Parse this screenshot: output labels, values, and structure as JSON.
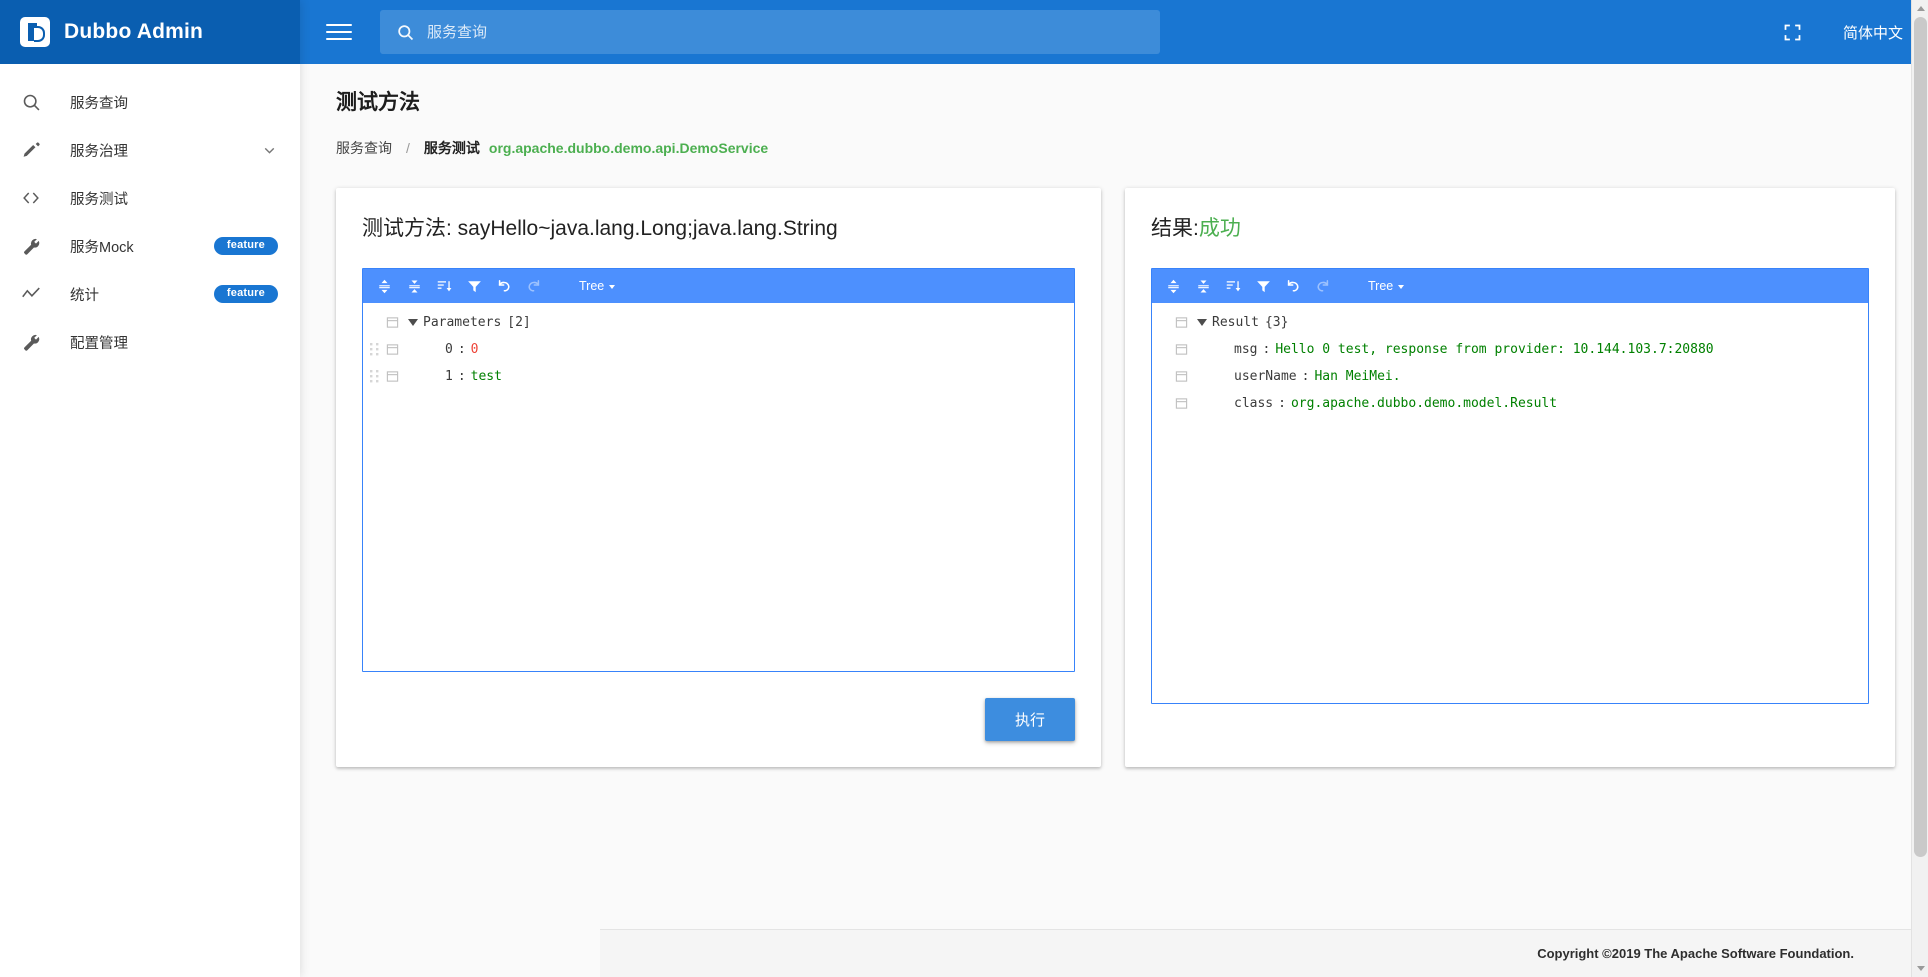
{
  "brand": {
    "title": "Dubbo Admin",
    "logo_icon": "dubbo-logo-icon"
  },
  "sidebar": {
    "items": [
      {
        "label": "服务查询",
        "icon": "search-icon",
        "badge": null,
        "chevron": false
      },
      {
        "label": "服务治理",
        "icon": "pencil-icon",
        "badge": null,
        "chevron": true
      },
      {
        "label": "服务测试",
        "icon": "code-brackets-icon",
        "badge": null,
        "chevron": false
      },
      {
        "label": "服务Mock",
        "icon": "wrench-icon",
        "badge": "feature",
        "chevron": false
      },
      {
        "label": "统计",
        "icon": "chart-line-icon",
        "badge": "feature",
        "chevron": false
      },
      {
        "label": "配置管理",
        "icon": "wrench-icon",
        "badge": null,
        "chevron": false
      }
    ]
  },
  "topbar": {
    "menu_icon": "hamburger-icon",
    "search_icon": "search-icon",
    "search_value": "",
    "search_placeholder": "服务查询",
    "fullscreen_icon": "fullscreen-icon",
    "language": "简体中文"
  },
  "page": {
    "title": "测试方法",
    "breadcrumb": {
      "root": "服务查询",
      "separator": "/",
      "current": "服务测试",
      "service": "org.apache.dubbo.demo.api.DemoService"
    }
  },
  "left_card": {
    "title_prefix": "测试方法: ",
    "method": "sayHello~java.lang.Long;java.lang.String",
    "editor": {
      "mode_label": "Tree",
      "buttons": [
        {
          "name": "expand-all-icon",
          "title": "Expand all fields"
        },
        {
          "name": "collapse-all-icon",
          "title": "Collapse all fields"
        },
        {
          "name": "sort-icon",
          "title": "Sort"
        },
        {
          "name": "filter-icon",
          "title": "Filter"
        },
        {
          "name": "undo-icon",
          "title": "Undo"
        },
        {
          "name": "redo-icon",
          "title": "Redo"
        }
      ],
      "rows": [
        {
          "key": "Parameters",
          "count": "[2]",
          "value": null,
          "vtype": "none",
          "root": true,
          "indent": 0
        },
        {
          "key": "0",
          "count": null,
          "value": "0",
          "vtype": "number",
          "root": false,
          "indent": 1
        },
        {
          "key": "1",
          "count": null,
          "value": "test",
          "vtype": "string",
          "root": false,
          "indent": 1
        }
      ]
    },
    "execute_label": "执行"
  },
  "right_card": {
    "title_prefix": "结果:",
    "status": "成功",
    "editor": {
      "mode_label": "Tree",
      "buttons": [
        {
          "name": "expand-all-icon",
          "title": "Expand all fields"
        },
        {
          "name": "collapse-all-icon",
          "title": "Collapse all fields"
        },
        {
          "name": "sort-icon",
          "title": "Sort"
        },
        {
          "name": "filter-icon",
          "title": "Filter"
        },
        {
          "name": "undo-icon",
          "title": "Undo"
        },
        {
          "name": "redo-icon",
          "title": "Redo"
        }
      ],
      "rows": [
        {
          "key": "Result",
          "count": "{3}",
          "value": null,
          "vtype": "none",
          "root": true,
          "indent": 0
        },
        {
          "key": "msg",
          "count": null,
          "value": "Hello 0 test, response from provider: 10.144.103.7:20880",
          "vtype": "string",
          "root": false,
          "indent": 1
        },
        {
          "key": "userName",
          "count": null,
          "value": "Han MeiMei.",
          "vtype": "string",
          "root": false,
          "indent": 1
        },
        {
          "key": "class",
          "count": null,
          "value": "org.apache.dubbo.demo.model.Result",
          "vtype": "string",
          "root": false,
          "indent": 1
        }
      ]
    }
  },
  "footer": {
    "copyright": "Copyright ©2019 The Apache Software Foundation."
  },
  "colors": {
    "brand_dark_blue": "#0a5eb0",
    "topbar_blue": "#1976d2",
    "editor_menu_blue": "#4d90fe",
    "accent_green": "#4caf50",
    "value_number": "#ed4337",
    "value_string": "#008000",
    "button_blue": "#3d8ddf"
  }
}
